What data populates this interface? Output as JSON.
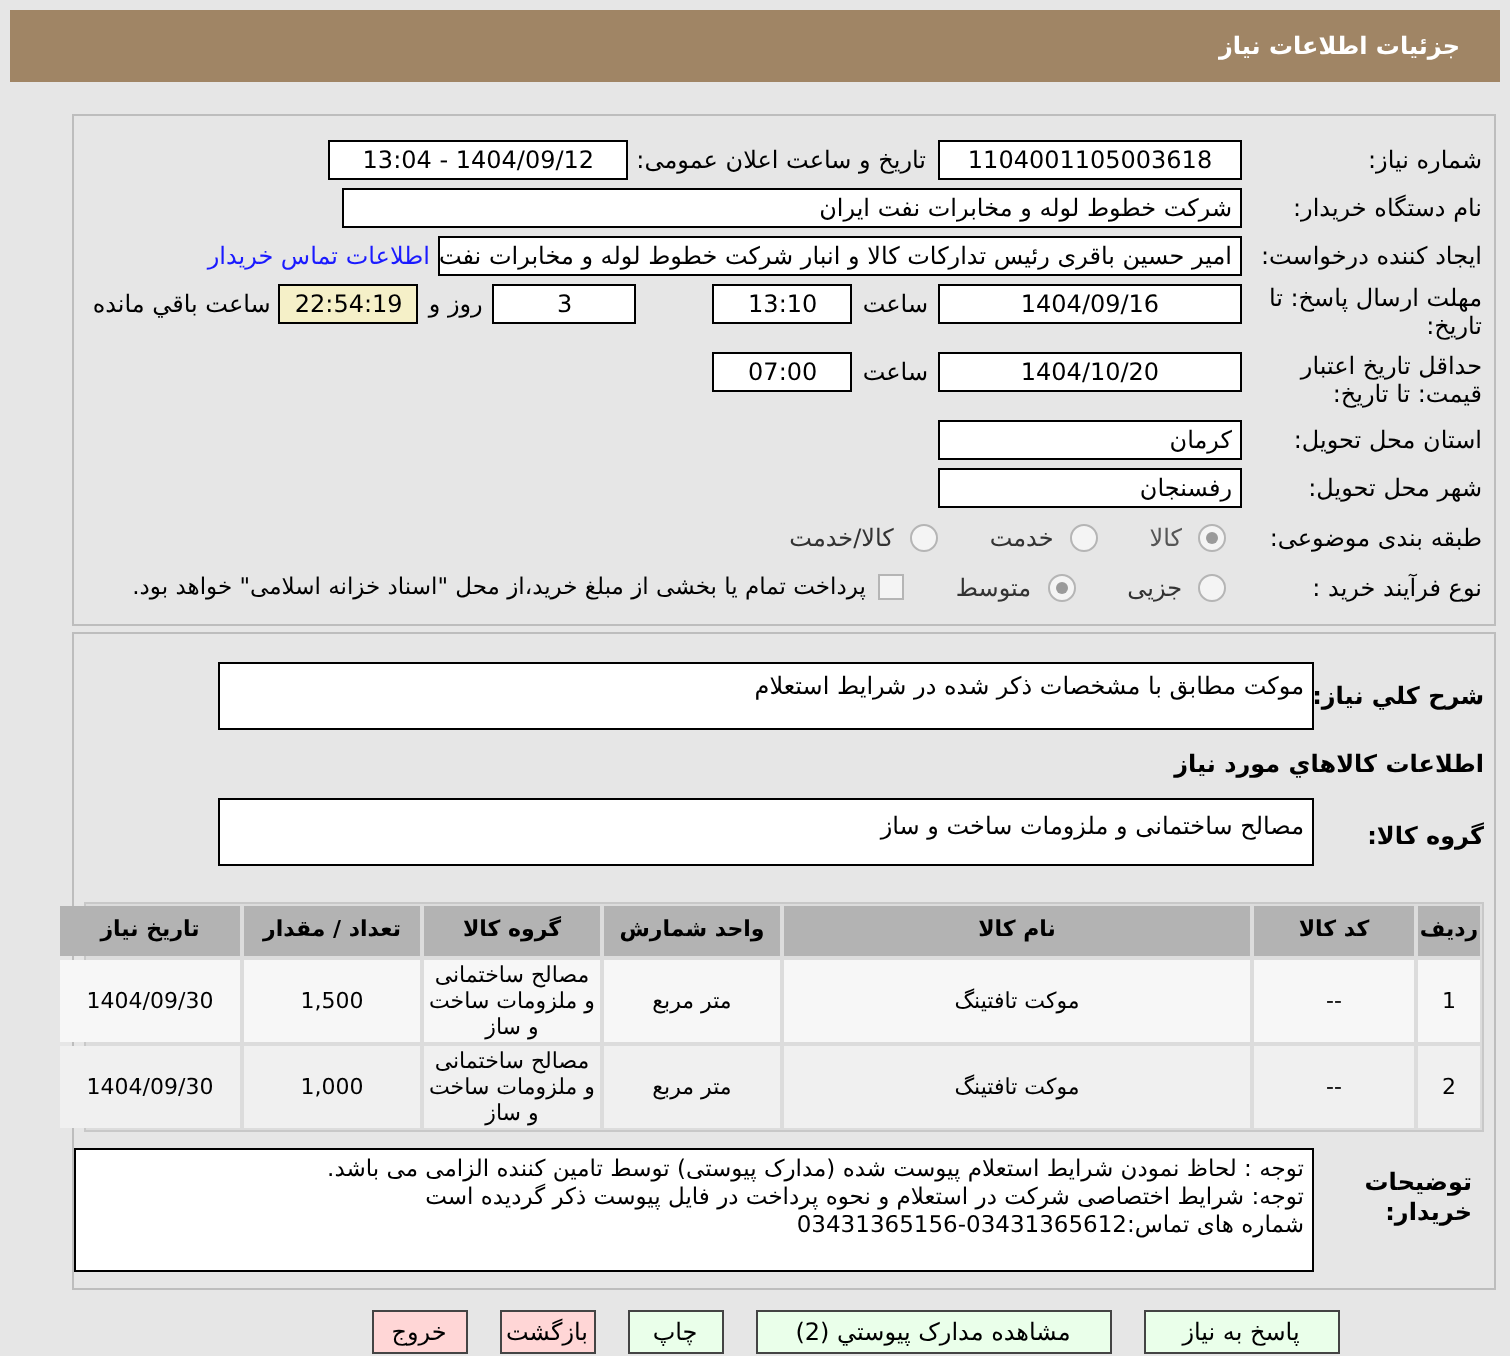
{
  "header": {
    "title": "جزئیات اطلاعات نیاز"
  },
  "need_number": {
    "label": "شماره نیاز:",
    "value": "1104001105003618"
  },
  "announce": {
    "label": "تاریخ و ساعت اعلان عمومی:",
    "value": "1404/09/12 - 13:04"
  },
  "buyer_org": {
    "label": "نام دستگاه خریدار:",
    "value": "شرکت خطوط لوله و مخابرات نفت ایران"
  },
  "requester": {
    "label": "ایجاد کننده درخواست:",
    "value": "امیر حسین  باقری  رئیس تدارکات کالا و انبار  شرکت خطوط لوله و مخابرات نفت",
    "link": "اطلاعات تماس خریدار"
  },
  "response_deadline": {
    "label": "مهلت ارسال پاسخ: تا تاریخ:",
    "date": "1404/09/16",
    "time_label": "ساعت",
    "time": "13:10",
    "days": "3",
    "days_label": "روز و",
    "remaining": "22:54:19",
    "remaining_label": "ساعت باقي مانده"
  },
  "price_validity": {
    "label": "حداقل تاریخ اعتبار قیمت: تا تاریخ:",
    "date": "1404/10/20",
    "time_label": "ساعت",
    "time": "07:00"
  },
  "province": {
    "label": "استان محل تحویل:",
    "value": "کرمان"
  },
  "city": {
    "label": "شهر محل تحویل:",
    "value": "رفسنجان"
  },
  "category": {
    "label": "طبقه بندی موضوعی:",
    "options": [
      {
        "label": "کالا",
        "selected": true
      },
      {
        "label": "خدمت",
        "selected": false
      },
      {
        "label": "کالا/خدمت",
        "selected": false
      }
    ]
  },
  "purchase_type": {
    "label": "نوع فرآیند خرید :",
    "options": [
      {
        "label": "جزیی",
        "selected": false
      },
      {
        "label": "متوسط",
        "selected": true
      }
    ],
    "treasury": {
      "label": "پرداخت تمام یا بخشی از مبلغ خرید،از محل \"اسناد خزانه اسلامی\" خواهد بود.",
      "checked": false
    }
  },
  "description": {
    "label": "شرح کلي نياز:",
    "value": "موکت مطابق با مشخصات ذکر شده در شرایط استعلام"
  },
  "goods_title": "اطلاعات کالاهاي مورد نياز",
  "goods_group": {
    "label": "گروه کالا:",
    "value": "مصالح ساختمانی و ملزومات ساخت و ساز"
  },
  "table": {
    "columns": [
      "ردیف",
      "کد کالا",
      "نام کالا",
      "واحد شمارش",
      "گروه کالا",
      "تعداد / مقدار",
      "تاریخ نیاز"
    ],
    "rows": [
      [
        "1",
        "--",
        "موکت تافتینگ",
        "متر مربع",
        "مصالح ساختمانی و ملزومات ساخت و ساز",
        "1,500",
        "1404/09/30"
      ],
      [
        "2",
        "--",
        "موکت تافتینگ",
        "متر مربع",
        "مصالح ساختمانی و ملزومات ساخت و ساز",
        "1,000",
        "1404/09/30"
      ]
    ]
  },
  "buyer_notes": {
    "label": "توضیحات خریدار:",
    "lines": [
      "توجه : لحاظ نمودن شرایط استعلام پیوست شده (مدارک پیوستی) توسط تامین کننده الزامی می باشد.",
      "توجه: شرایط اختصاصی شرکت در استعلام و نحوه پرداخت در فایل پیوست ذکر گردیده است",
      "شماره های تماس:03431365612-03431365156"
    ]
  },
  "buttons": [
    {
      "label": "پاسخ به نیاز",
      "kind": "normal"
    },
    {
      "label": "مشاهده مدارک پیوستي (2)",
      "kind": "normal"
    },
    {
      "label": "چاپ",
      "kind": "normal"
    },
    {
      "label": "بازگشت",
      "kind": "danger"
    },
    {
      "label": "خروج",
      "kind": "danger"
    }
  ]
}
